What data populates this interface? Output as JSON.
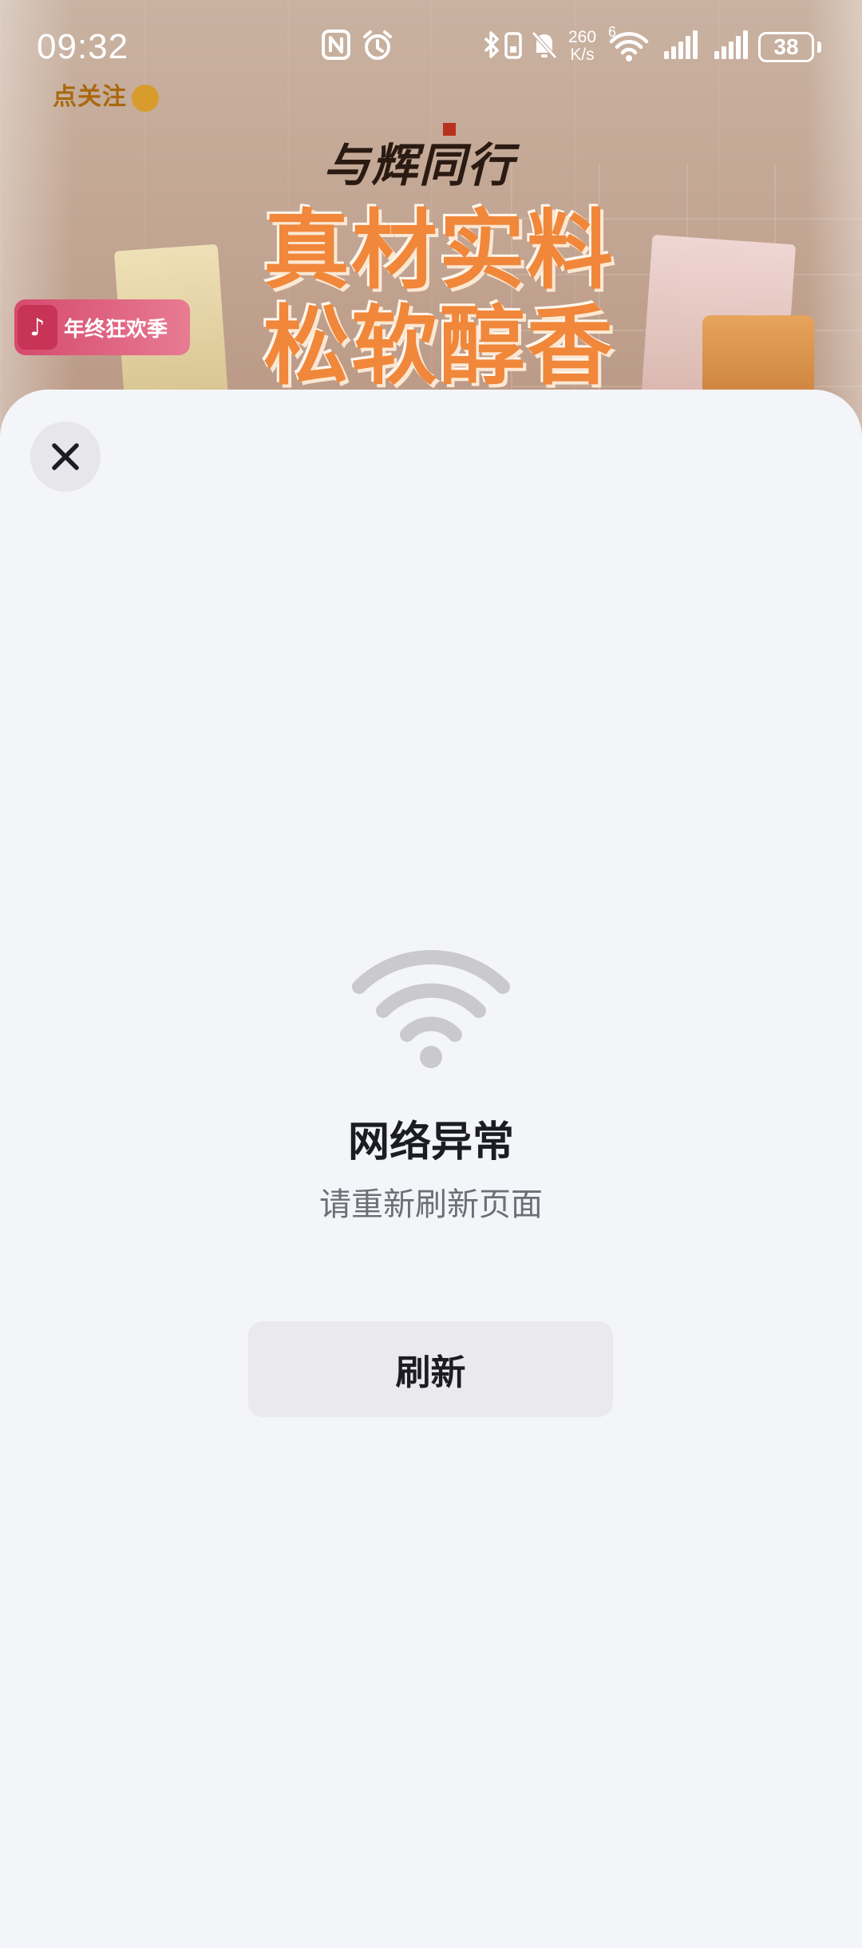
{
  "status_bar": {
    "time": "09:32",
    "net_speed_value": "260",
    "net_speed_unit": "K/s",
    "wifi_badge": "6",
    "battery_level": "38",
    "icons": [
      "nfc-icon",
      "alarm-icon",
      "bluetooth-icon",
      "vibrate-icon",
      "mute-bell-icon",
      "wifi6-icon",
      "cellular-signal-icon",
      "cellular-signal-icon",
      "battery-icon"
    ]
  },
  "background_banner": {
    "follow_tag": "点关注",
    "brand_logo": "与辉同行",
    "headline_line1": "真材实料",
    "headline_line2": "松软醇香",
    "promo_tag": "年终狂欢季"
  },
  "sheet": {
    "close_icon": "close-icon",
    "error_icon": "wifi-icon",
    "error_title": "网络异常",
    "error_subtitle": "请重新刷新页面",
    "refresh_label": "刷新"
  },
  "colors": {
    "sheet_background": "#f4f5f9",
    "button_background": "#e9e9ee",
    "title_text": "#1c1c24",
    "subtitle_text": "#6e6e78",
    "wifi_icon": "#c9c9ce",
    "headline_orange": "#f0873a"
  }
}
